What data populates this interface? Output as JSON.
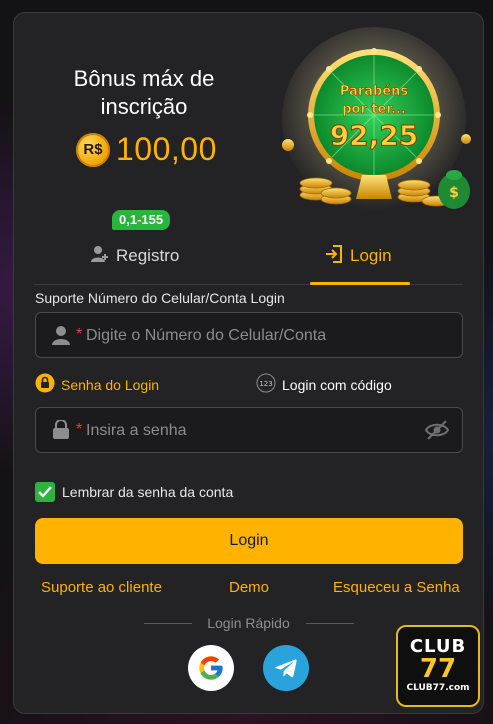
{
  "banner": {
    "title": "Bônus máx de inscrição",
    "currency_symbol": "R$",
    "amount": "100,00",
    "wheel_line1": "Parabéns",
    "wheel_line2": "por ter...",
    "wheel_value": "92,25"
  },
  "tabs": {
    "register_label": "Registro",
    "register_badge": "0,1-155",
    "login_label": "Login",
    "active": "login"
  },
  "form": {
    "account_label": "Suporte Número do Celular/Conta Login",
    "account_placeholder": "Digite o Número do Celular/Conta",
    "account_value": "",
    "mode_password_label": "Senha do Login",
    "mode_code_label": "Login com código",
    "code_icon_text": "123",
    "password_placeholder": "Insira a senha",
    "password_value": "",
    "required_mark": "*",
    "remember_label": "Lembrar da senha da conta",
    "remember_checked": true,
    "login_button": "Login"
  },
  "links": {
    "support": "Suporte ao cliente",
    "demo": "Demo",
    "forgot": "Esqueceu a Senha"
  },
  "quick_login": {
    "title": "Login Rápido",
    "providers": [
      "google-icon",
      "telegram-icon"
    ]
  },
  "logo": {
    "line1": "CLUB",
    "line2": "77",
    "line3": "CLUB77.com"
  },
  "colors": {
    "accent": "#ffb300",
    "panel": "#232224",
    "badge_green": "#27b53c",
    "telegram": "#2aa3dc"
  }
}
